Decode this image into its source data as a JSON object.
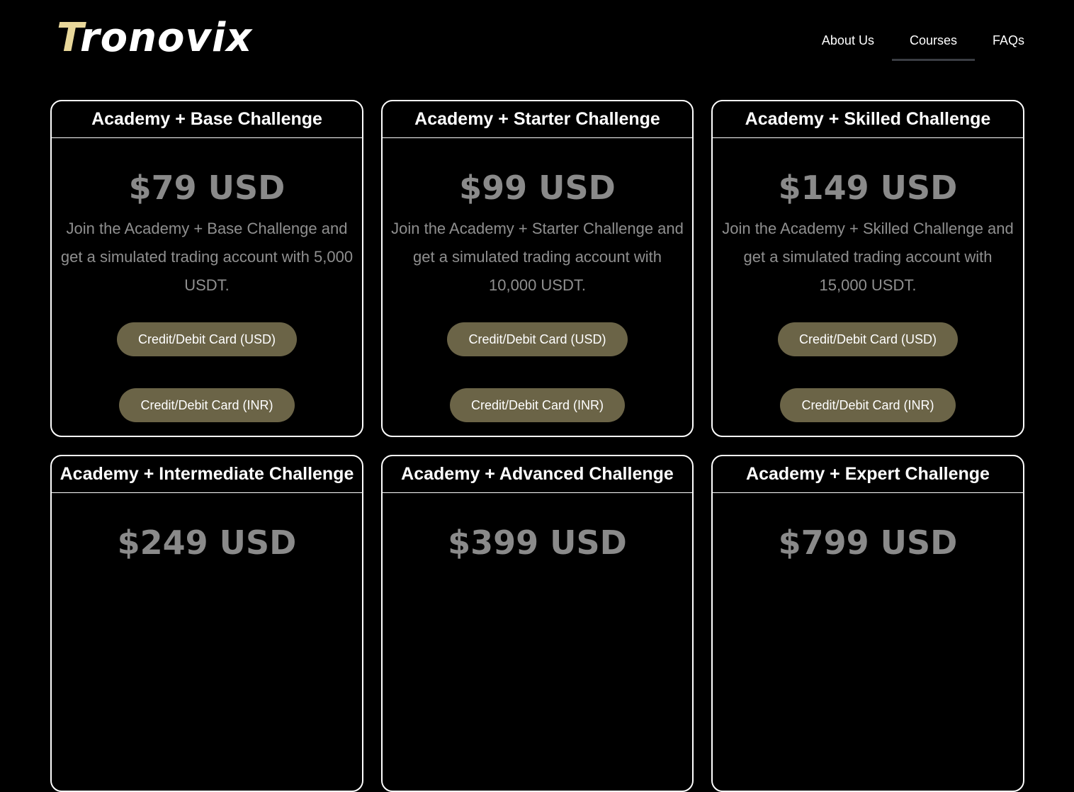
{
  "brand": {
    "logo_first": "T",
    "logo_rest": "ronovix"
  },
  "nav": [
    {
      "label": "About Us"
    },
    {
      "label": "Courses"
    },
    {
      "label": "FAQs"
    }
  ],
  "cards": [
    {
      "title": "Academy + Base Challenge",
      "price": "$79 USD",
      "description": "Join the Academy + Base Challenge and get a simulated trading account with 5,000 USDT.",
      "btn_usd": "Credit/Debit Card (USD)",
      "btn_inr": "Credit/Debit Card (INR)"
    },
    {
      "title": "Academy + Starter Challenge",
      "price": "$99 USD",
      "description": "Join the Academy + Starter Challenge and get a simulated trading account with 10,000 USDT.",
      "btn_usd": "Credit/Debit Card (USD)",
      "btn_inr": "Credit/Debit Card (INR)"
    },
    {
      "title": "Academy + Skilled Challenge",
      "price": "$149 USD",
      "description": "Join the Academy + Skilled Challenge and get a simulated trading account with 15,000 USDT.",
      "btn_usd": "Credit/Debit Card (USD)",
      "btn_inr": "Credit/Debit Card (INR)"
    },
    {
      "title": "Academy + Intermediate Challenge",
      "price": "$249 USD",
      "description": "",
      "btn_usd": "",
      "btn_inr": ""
    },
    {
      "title": "Academy + Advanced Challenge",
      "price": "$399 USD",
      "description": "",
      "btn_usd": "",
      "btn_inr": ""
    },
    {
      "title": "Academy + Expert Challenge",
      "price": "$799 USD",
      "description": "",
      "btn_usd": "",
      "btn_inr": ""
    }
  ],
  "colors": {
    "background": "#000000",
    "logo_accent": "#e8d79a",
    "button": "#6b6447",
    "price_text": "#8a8a8a"
  }
}
